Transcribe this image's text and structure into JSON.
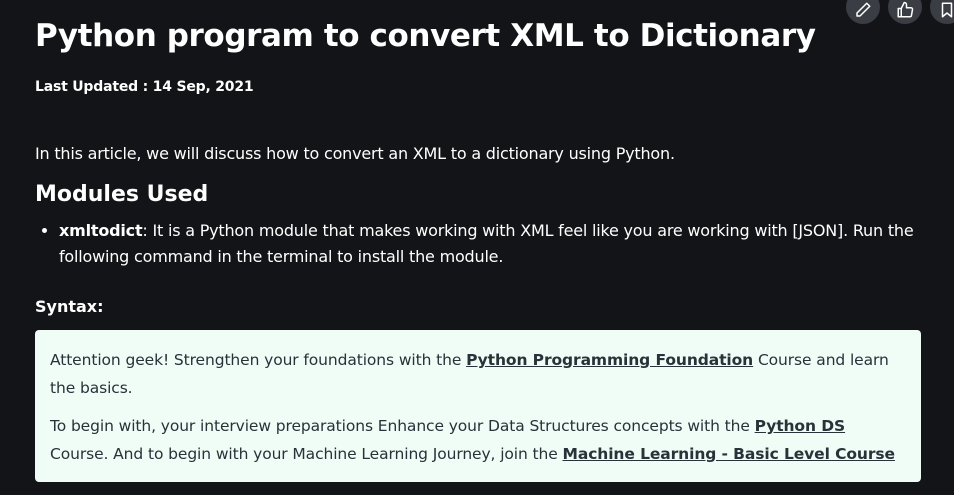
{
  "article": {
    "title": "Python program to convert XML to Dictionary",
    "last_updated": "Last Updated : 14 Sep, 2021",
    "intro": "In this article, we will discuss how to convert an XML to a dictionary using Python.",
    "section_heading": "Modules Used",
    "bullets": [
      {
        "term": "xmltodict",
        "text": ": It is a Python module that makes working with XML feel like you are working with [JSON]. Run the following command in the terminal to install the module."
      }
    ],
    "syntax_label": "Syntax:"
  },
  "actions": {
    "edit_icon": "pencil-icon",
    "like_icon": "thumbs-up-icon",
    "bookmark_icon": "bookmark-icon"
  },
  "promo": {
    "line1_prefix": " Attention geek! Strengthen your foundations with the ",
    "line1_link": "Python Programming Foundation",
    "line1_suffix": " Course and learn the basics.",
    "line2_prefix": "To begin with, your interview preparations Enhance your Data Structures concepts with the ",
    "line2_link": "Python DS",
    "line2_mid": " Course. And to begin with your Machine Learning Journey, join the ",
    "line2_link2": "Machine Learning - Basic Level Course"
  },
  "colors": {
    "page_bg": "#131417",
    "button_bg": "#3a3d44",
    "promo_bg": "#f0fcf6",
    "promo_text": "#273239"
  }
}
